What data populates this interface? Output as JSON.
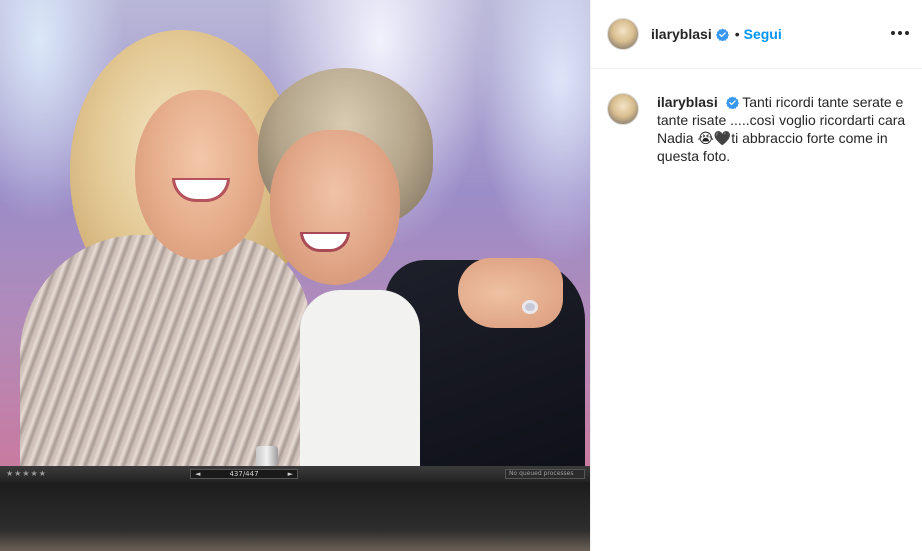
{
  "post": {
    "image_alt": "Two women smiling and hugging",
    "screen_bar": {
      "stars": "★★★★★",
      "prev_label": "◄",
      "counter": "437/447",
      "next_label": "►",
      "queue_label": "No queued processes"
    }
  },
  "header": {
    "username": "ilaryblasi",
    "separator": "•",
    "follow_label": "Segui",
    "more_icon": "more-options-icon"
  },
  "caption": {
    "username": "ilaryblasi",
    "text": "Tanti ricordi tante serate e tante risate .....così voglio ricordarti cara Nadia 😭🖤ti abbraccio forte come in questa foto."
  },
  "colors": {
    "accent": "#0095f6",
    "verified": "#3897f0",
    "text": "#262626",
    "border": "#efefef"
  }
}
